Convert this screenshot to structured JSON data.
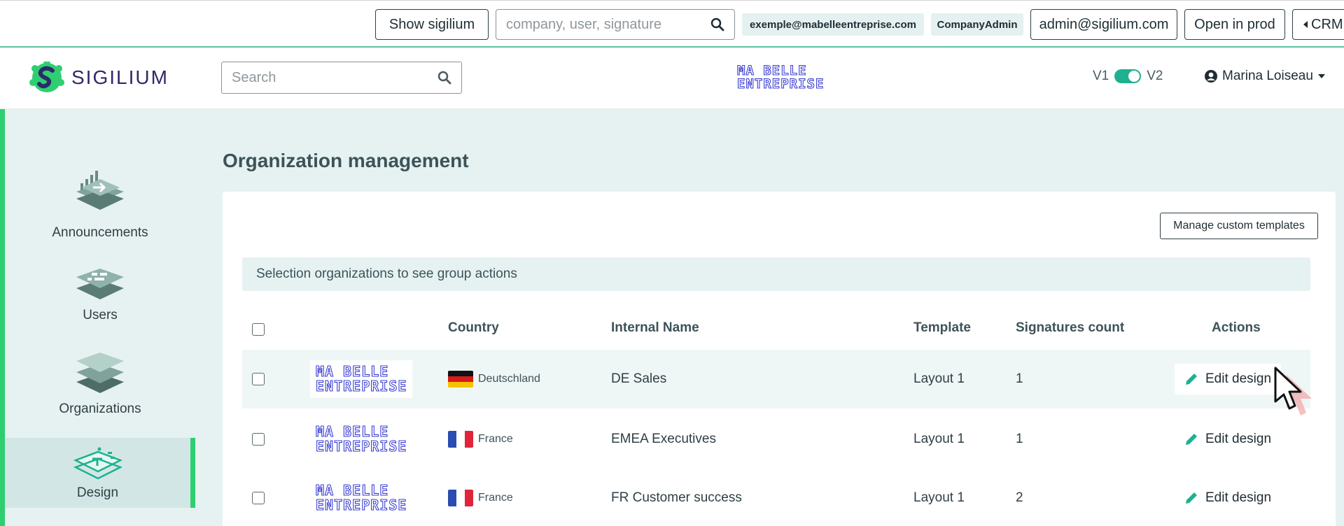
{
  "admin_bar": {
    "show_button": "Show sigilium",
    "search_placeholder": "company, user, signature",
    "company_email": "exemple@mabelleentreprise.com",
    "role": "CompanyAdmin",
    "admin_email": "admin@sigilium.com",
    "open_prod": "Open in prod",
    "crm": "CRM"
  },
  "header": {
    "brand": "SIGILIUM",
    "search_placeholder": "Search",
    "company_logo_line1": "MA BELLE",
    "company_logo_line2": "ENTREPRISE",
    "v1": "V1",
    "v2": "V2",
    "user_name": "Marina Loiseau"
  },
  "sidebar": {
    "items": [
      {
        "label": "Announcements"
      },
      {
        "label": "Users"
      },
      {
        "label": "Organizations"
      },
      {
        "label": "Design"
      }
    ]
  },
  "main": {
    "title": "Organization management",
    "manage_templates": "Manage custom templates",
    "selection_hint": "Selection organizations to see group actions",
    "columns": {
      "country": "Country",
      "internal_name": "Internal Name",
      "template": "Template",
      "signatures_count": "Signatures count",
      "actions": "Actions"
    },
    "rows": [
      {
        "logo1": "MA BELLE",
        "logo2": "ENTREPRISE",
        "country": "Deutschland",
        "name": "DE Sales",
        "template": "Layout 1",
        "count": "1",
        "action": "Edit design"
      },
      {
        "logo1": "MA BELLE",
        "logo2": "ENTREPRISE",
        "country": "France",
        "name": "EMEA Executives",
        "template": "Layout 1",
        "count": "1",
        "action": "Edit design"
      },
      {
        "logo1": "MA BELLE",
        "logo2": "ENTREPRISE",
        "country": "France",
        "name": "FR Customer success",
        "template": "Layout 1",
        "count": "2",
        "action": "Edit design"
      }
    ]
  },
  "colors": {
    "accent": "#1fb090",
    "sidebar_bg": "#e6f2f1",
    "active_bar": "#2ecf71",
    "logo_blue": "#3b3fd1"
  },
  "icons": {
    "search": "search-icon",
    "user": "user-circle-icon",
    "caret": "caret-down-icon",
    "pencil": "pencil-icon",
    "caret_left": "caret-left-icon"
  }
}
